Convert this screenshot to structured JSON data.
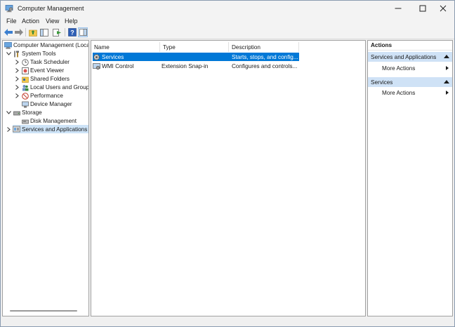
{
  "window": {
    "title": "Computer Management"
  },
  "menu": [
    "File",
    "Action",
    "View",
    "Help"
  ],
  "tree": {
    "root": "Computer Management (Local",
    "system_tools": "System Tools",
    "task_scheduler": "Task Scheduler",
    "event_viewer": "Event Viewer",
    "shared_folders": "Shared Folders",
    "local_users": "Local Users and Groups",
    "performance": "Performance",
    "device_manager": "Device Manager",
    "storage": "Storage",
    "disk_management": "Disk Management",
    "services_apps": "Services and Applications"
  },
  "list": {
    "columns": [
      "Name",
      "Type",
      "Description"
    ],
    "rows": [
      {
        "name": "Services",
        "type": "",
        "description": "Starts, stops, and config..."
      },
      {
        "name": "WMI Control",
        "type": "Extension Snap-in",
        "description": "Configures and controls..."
      }
    ]
  },
  "actions": {
    "header": "Actions",
    "section1": "Services and Applications",
    "section1_item": "More Actions",
    "section2": "Services",
    "section2_item": "More Actions"
  },
  "colors": {
    "selection": "#0078d7",
    "section_header": "#cfe2f6"
  }
}
